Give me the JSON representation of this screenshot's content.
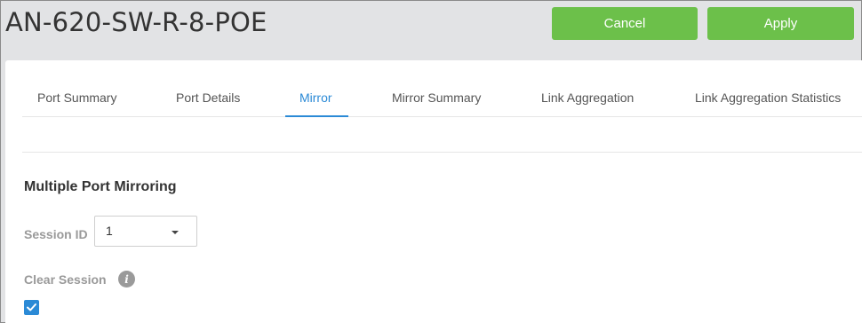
{
  "header": {
    "device_name": "AN-620-SW-R-8-POE",
    "cancel_label": "Cancel",
    "apply_label": "Apply",
    "button_color": "#6cc04a"
  },
  "tabs": [
    {
      "label": "Port Summary",
      "active": false
    },
    {
      "label": "Port Details",
      "active": false
    },
    {
      "label": "Mirror",
      "active": true
    },
    {
      "label": "Mirror Summary",
      "active": false
    },
    {
      "label": "Link Aggregation",
      "active": false
    },
    {
      "label": "Link Aggregation Statistics",
      "active": false
    }
  ],
  "section": {
    "title": "Multiple Port Mirroring",
    "session_id_label": "Session ID",
    "session_id_value": "1",
    "clear_session_label": "Clear Session",
    "clear_session_checked": true,
    "info_icon": "info-icon"
  },
  "colors": {
    "accent": "#2b8ad6",
    "background": "#e2e3e5"
  }
}
